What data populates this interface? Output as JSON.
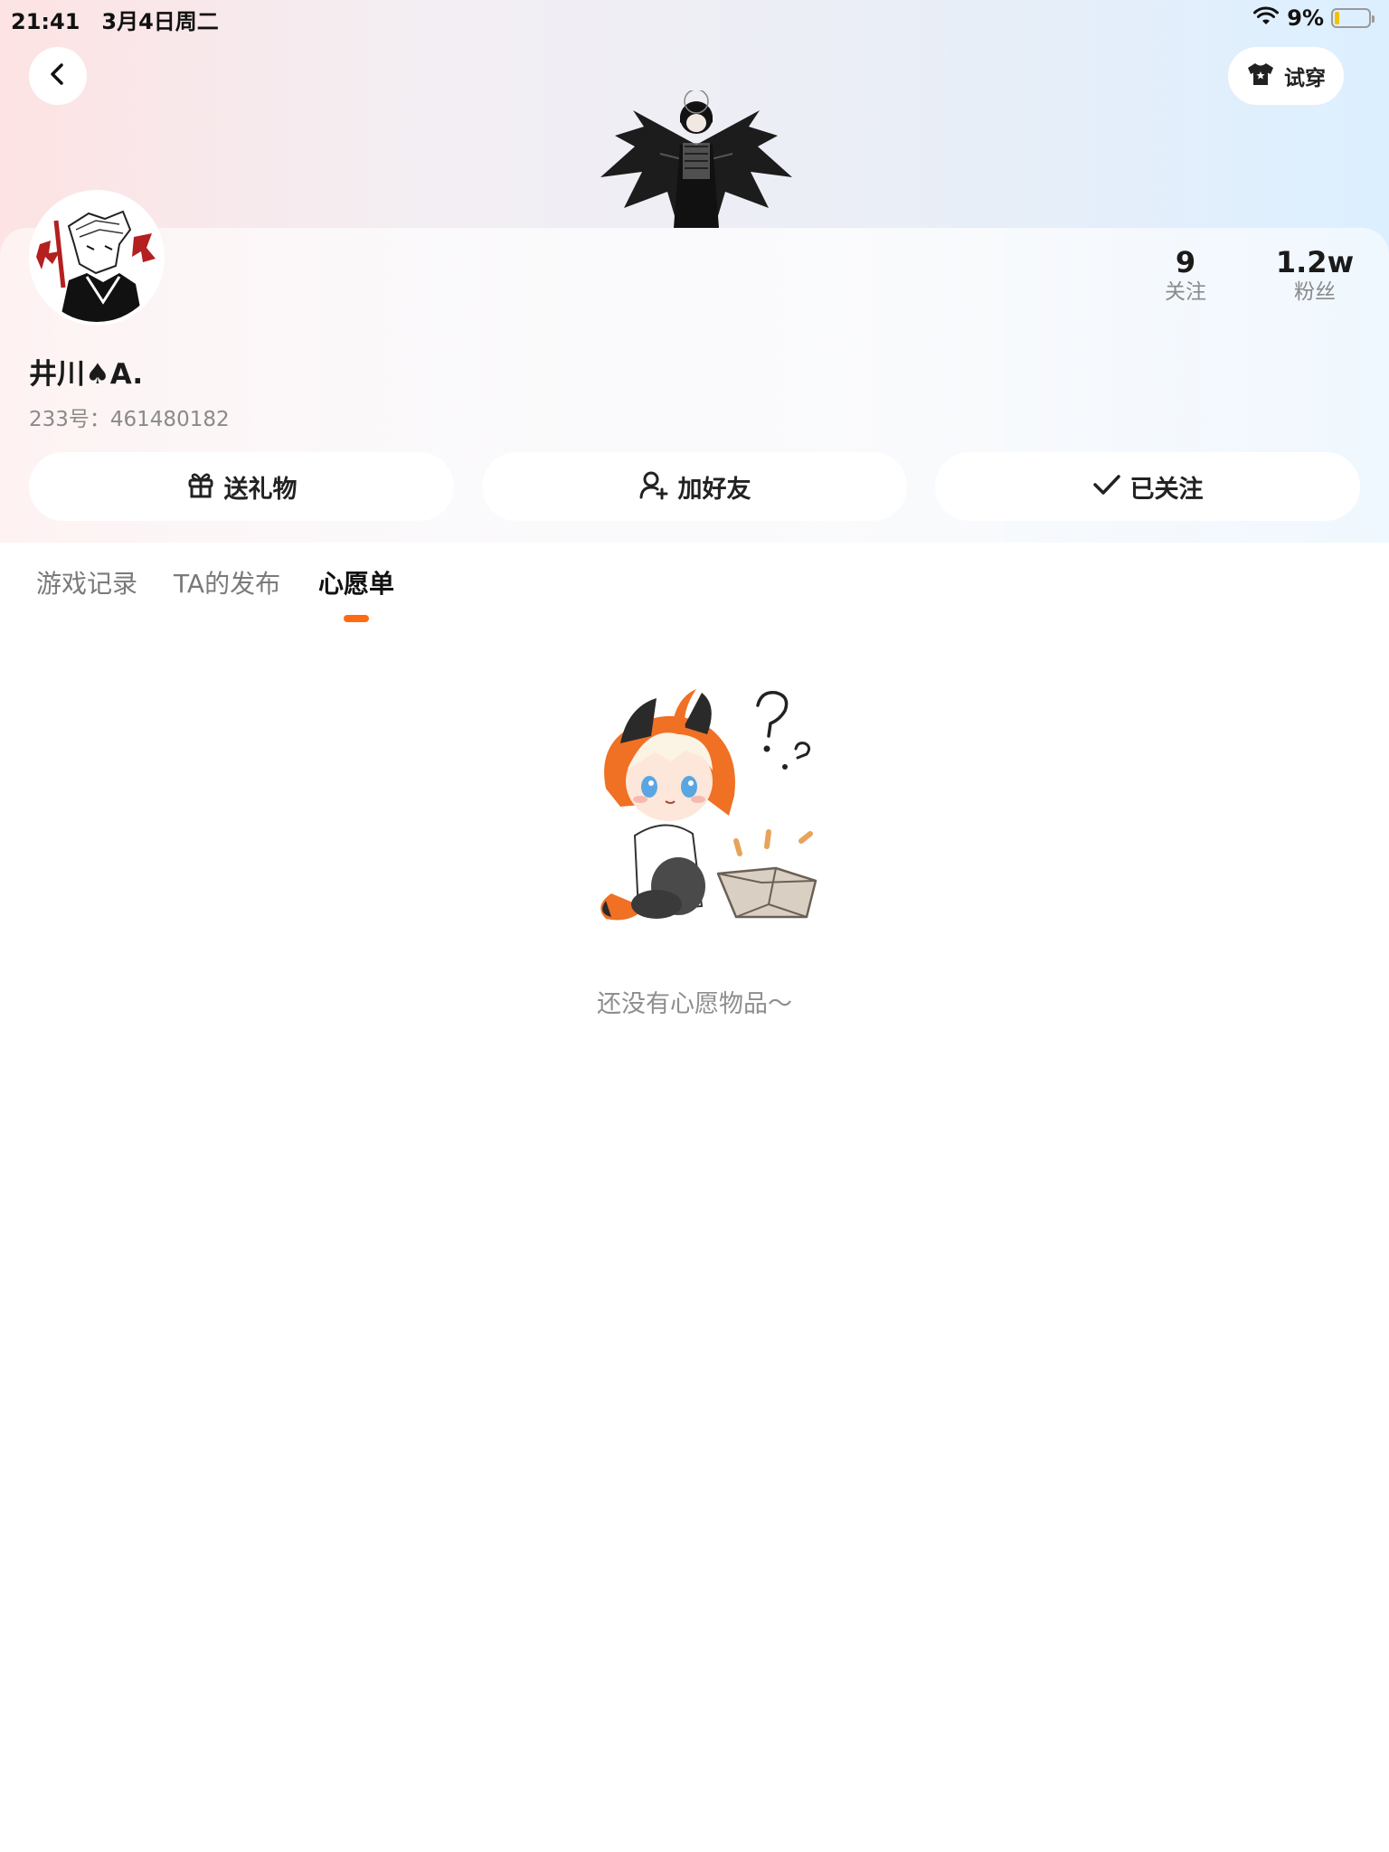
{
  "status_bar": {
    "time": "21:41",
    "date": "3月4日周二",
    "battery": "9%"
  },
  "header": {
    "try_on_label": "试穿"
  },
  "profile": {
    "username": "井川♠A.",
    "user_id": "233号：461480182",
    "stats": [
      {
        "value": "9",
        "label": "关注"
      },
      {
        "value": "1.2w",
        "label": "粉丝"
      }
    ],
    "actions": [
      {
        "label": "送礼物",
        "icon": "gift-icon"
      },
      {
        "label": "加好友",
        "icon": "add-friend-icon"
      },
      {
        "label": "已关注",
        "icon": "check-icon"
      }
    ]
  },
  "tabs": [
    {
      "label": "游戏记录",
      "active": false
    },
    {
      "label": "TA的发布",
      "active": false
    },
    {
      "label": "心愿单",
      "active": true
    }
  ],
  "empty_state": {
    "message": "还没有心愿物品～"
  },
  "colors": {
    "accent": "#ff6a13",
    "muted_text": "#8e8e8e"
  }
}
